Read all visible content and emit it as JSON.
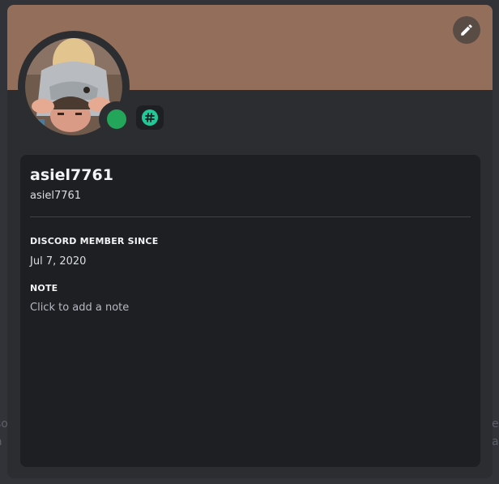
{
  "backdrop": {
    "left_fragment": "so\na",
    "right_fragment": "e\na"
  },
  "profile": {
    "display_name": "asiel7761",
    "username": "asiel7761",
    "status": "online",
    "banner_color": "#936f5b",
    "badge_icon": "hashtag-badge-icon",
    "edit_icon": "pencil-icon"
  },
  "sections": {
    "member_since_heading": "DISCORD MEMBER SINCE",
    "member_since_value": "Jul 7, 2020",
    "note_heading": "NOTE",
    "note_placeholder": "Click to add a note"
  },
  "colors": {
    "status_online": "#23a55a",
    "badge": "#20c997"
  }
}
